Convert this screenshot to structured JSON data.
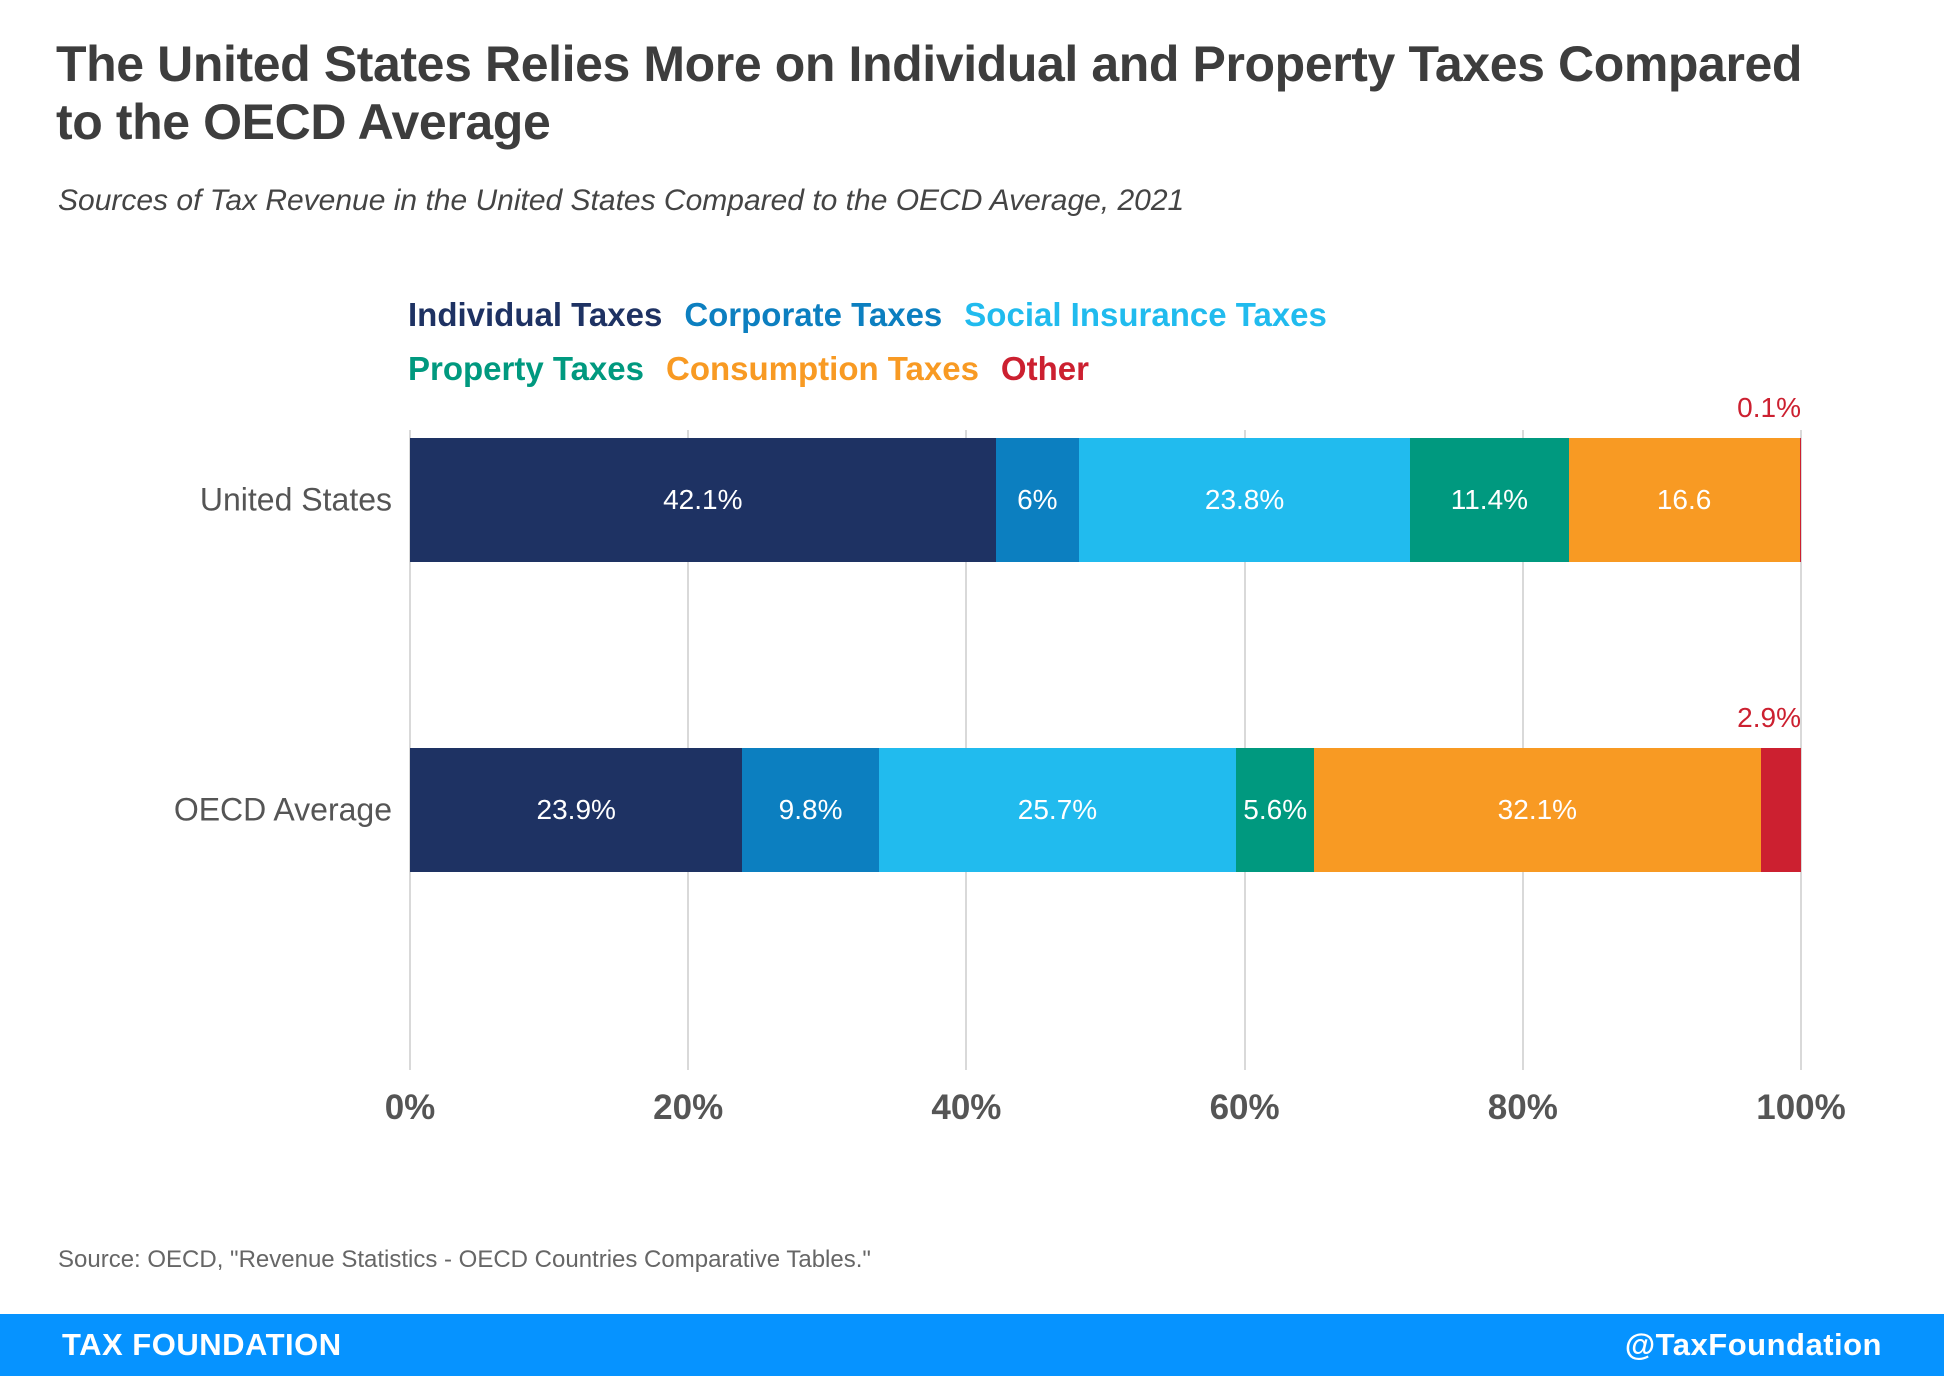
{
  "header": {
    "title": "The United States Relies More on Individual and Property Taxes Compared to the OECD Average",
    "subtitle": "Sources of Tax Revenue in the United States Compared to the OECD Average, 2021"
  },
  "source_note": "Source: OECD, \"Revenue Statistics - OECD Countries Comparative Tables.\"",
  "footer": {
    "brand": "TAX FOUNDATION",
    "handle": "@TaxFoundation",
    "background": "#0693ff"
  },
  "colors": {
    "individual": "#1e3263",
    "corporate": "#0c7fc0",
    "social": "#21bbee",
    "property": "#00997f",
    "consumption": "#f89a23",
    "other": "#cc2030",
    "gridline": "#d9d9d9",
    "axis_text": "#555555",
    "title_text": "#3d3d3d"
  },
  "chart_data": {
    "type": "bar",
    "orientation": "horizontal",
    "stacked": true,
    "normalized": true,
    "title": "The United States Relies More on Individual and Property Taxes Compared to the OECD Average",
    "subtitle": "Sources of Tax Revenue in the United States Compared to the OECD Average, 2021",
    "xlabel": "",
    "ylabel": "",
    "xlim": [
      0,
      100
    ],
    "xticks": [
      0,
      20,
      40,
      60,
      80,
      100
    ],
    "xtick_labels": [
      "0%",
      "20%",
      "40%",
      "60%",
      "80%",
      "100%"
    ],
    "grid": true,
    "legend_position": "top",
    "categories": [
      "United States",
      "OECD Average"
    ],
    "series": [
      {
        "name": "Individual Taxes",
        "color": "#1e3263",
        "values": [
          42.1,
          23.9
        ],
        "labels": [
          "42.1%",
          "23.9%"
        ],
        "label_position": [
          "inside",
          "inside"
        ]
      },
      {
        "name": "Corporate Taxes",
        "color": "#0c7fc0",
        "values": [
          6.0,
          9.8
        ],
        "labels": [
          "6%",
          "9.8%"
        ],
        "label_position": [
          "inside",
          "inside"
        ]
      },
      {
        "name": "Social Insurance Taxes",
        "color": "#21bbee",
        "values": [
          23.8,
          25.7
        ],
        "labels": [
          "23.8%",
          "25.7%"
        ],
        "label_position": [
          "inside",
          "inside"
        ]
      },
      {
        "name": "Property Taxes",
        "color": "#00997f",
        "values": [
          11.4,
          5.6
        ],
        "labels": [
          "11.4%",
          "5.6%"
        ],
        "label_position": [
          "inside",
          "inside"
        ]
      },
      {
        "name": "Consumption Taxes",
        "color": "#f89a23",
        "values": [
          16.6,
          32.1
        ],
        "labels": [
          "16.6",
          "32.1%"
        ],
        "label_position": [
          "inside",
          "inside"
        ]
      },
      {
        "name": "Other",
        "color": "#cc2030",
        "values": [
          0.1,
          2.9
        ],
        "labels": [
          "0.1%",
          "2.9%"
        ],
        "label_position": [
          "outside",
          "outside"
        ]
      }
    ]
  }
}
